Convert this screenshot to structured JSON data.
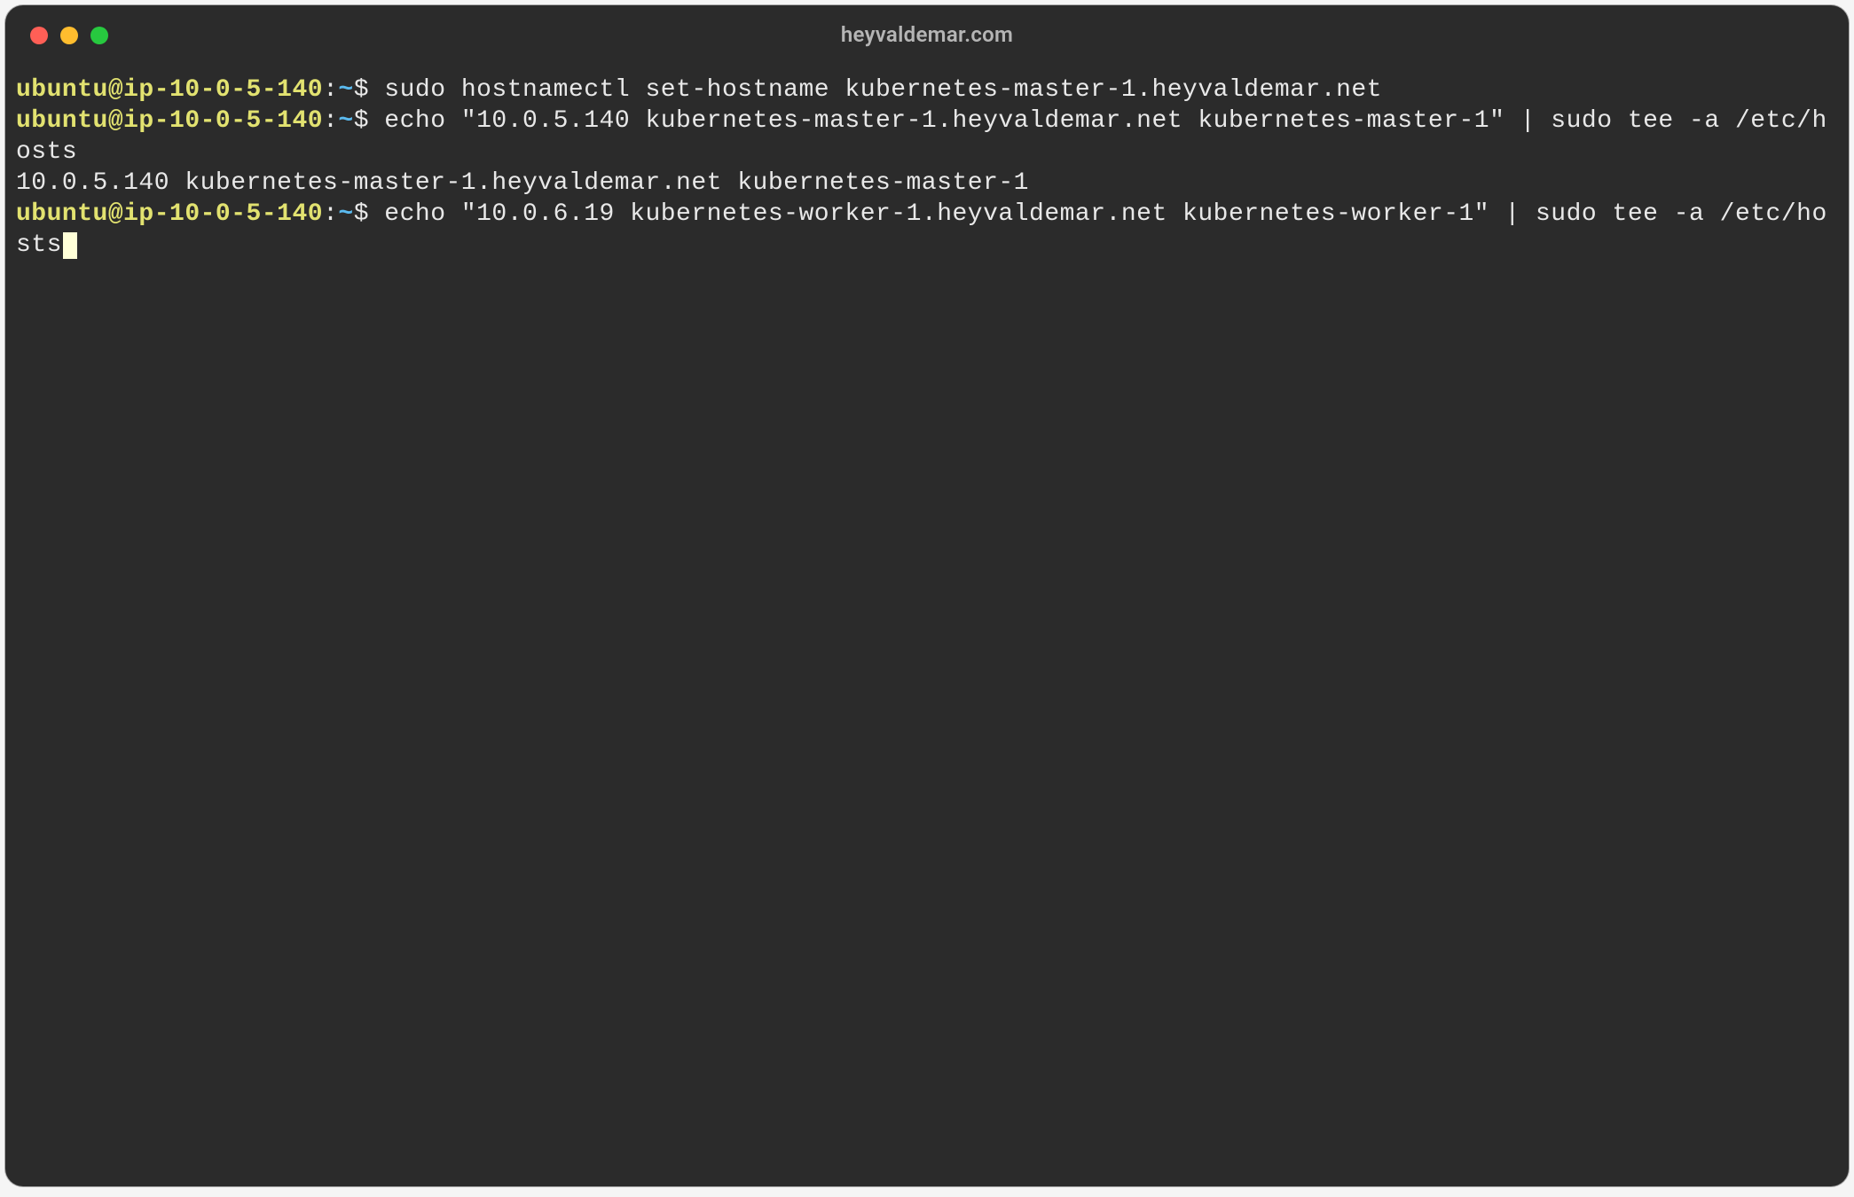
{
  "window": {
    "title": "heyvaldemar.com"
  },
  "prompt": {
    "user_host": "ubuntu@ip-10-0-5-140",
    "sep": ":",
    "path": "~",
    "symbol": "$"
  },
  "lines": {
    "cmd1": " sudo hostnamectl set-hostname kubernetes-master-1.heyvaldemar.net",
    "cmd2": " echo \"10.0.5.140 kubernetes-master-1.heyvaldemar.net kubernetes-master-1\" | sudo tee -a /etc/hosts",
    "out1": "10.0.5.140 kubernetes-master-1.heyvaldemar.net kubernetes-master-1",
    "cmd3": " echo \"10.0.6.19 kubernetes-worker-1.heyvaldemar.net kubernetes-worker-1\" | sudo tee -a /etc/hosts"
  }
}
